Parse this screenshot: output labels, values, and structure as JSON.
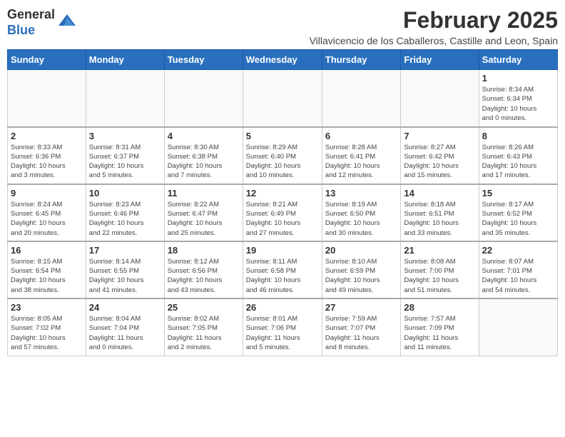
{
  "logo": {
    "general": "General",
    "blue": "Blue"
  },
  "title": {
    "month_year": "February 2025",
    "subtitle": "Villavicencio de los Caballeros, Castille and Leon, Spain"
  },
  "weekdays": [
    "Sunday",
    "Monday",
    "Tuesday",
    "Wednesday",
    "Thursday",
    "Friday",
    "Saturday"
  ],
  "days": [
    {
      "date": "",
      "info": ""
    },
    {
      "date": "",
      "info": ""
    },
    {
      "date": "",
      "info": ""
    },
    {
      "date": "",
      "info": ""
    },
    {
      "date": "",
      "info": ""
    },
    {
      "date": "",
      "info": ""
    },
    {
      "date": "1",
      "info": "Sunrise: 8:34 AM\nSunset: 6:34 PM\nDaylight: 10 hours\nand 0 minutes."
    },
    {
      "date": "2",
      "info": "Sunrise: 8:33 AM\nSunset: 6:36 PM\nDaylight: 10 hours\nand 3 minutes."
    },
    {
      "date": "3",
      "info": "Sunrise: 8:31 AM\nSunset: 6:37 PM\nDaylight: 10 hours\nand 5 minutes."
    },
    {
      "date": "4",
      "info": "Sunrise: 8:30 AM\nSunset: 6:38 PM\nDaylight: 10 hours\nand 7 minutes."
    },
    {
      "date": "5",
      "info": "Sunrise: 8:29 AM\nSunset: 6:40 PM\nDaylight: 10 hours\nand 10 minutes."
    },
    {
      "date": "6",
      "info": "Sunrise: 8:28 AM\nSunset: 6:41 PM\nDaylight: 10 hours\nand 12 minutes."
    },
    {
      "date": "7",
      "info": "Sunrise: 8:27 AM\nSunset: 6:42 PM\nDaylight: 10 hours\nand 15 minutes."
    },
    {
      "date": "8",
      "info": "Sunrise: 8:26 AM\nSunset: 6:43 PM\nDaylight: 10 hours\nand 17 minutes."
    },
    {
      "date": "9",
      "info": "Sunrise: 8:24 AM\nSunset: 6:45 PM\nDaylight: 10 hours\nand 20 minutes."
    },
    {
      "date": "10",
      "info": "Sunrise: 8:23 AM\nSunset: 6:46 PM\nDaylight: 10 hours\nand 22 minutes."
    },
    {
      "date": "11",
      "info": "Sunrise: 8:22 AM\nSunset: 6:47 PM\nDaylight: 10 hours\nand 25 minutes."
    },
    {
      "date": "12",
      "info": "Sunrise: 8:21 AM\nSunset: 6:49 PM\nDaylight: 10 hours\nand 27 minutes."
    },
    {
      "date": "13",
      "info": "Sunrise: 8:19 AM\nSunset: 6:50 PM\nDaylight: 10 hours\nand 30 minutes."
    },
    {
      "date": "14",
      "info": "Sunrise: 8:18 AM\nSunset: 6:51 PM\nDaylight: 10 hours\nand 33 minutes."
    },
    {
      "date": "15",
      "info": "Sunrise: 8:17 AM\nSunset: 6:52 PM\nDaylight: 10 hours\nand 35 minutes."
    },
    {
      "date": "16",
      "info": "Sunrise: 8:15 AM\nSunset: 6:54 PM\nDaylight: 10 hours\nand 38 minutes."
    },
    {
      "date": "17",
      "info": "Sunrise: 8:14 AM\nSunset: 6:55 PM\nDaylight: 10 hours\nand 41 minutes."
    },
    {
      "date": "18",
      "info": "Sunrise: 8:12 AM\nSunset: 6:56 PM\nDaylight: 10 hours\nand 43 minutes."
    },
    {
      "date": "19",
      "info": "Sunrise: 8:11 AM\nSunset: 6:58 PM\nDaylight: 10 hours\nand 46 minutes."
    },
    {
      "date": "20",
      "info": "Sunrise: 8:10 AM\nSunset: 6:59 PM\nDaylight: 10 hours\nand 49 minutes."
    },
    {
      "date": "21",
      "info": "Sunrise: 8:08 AM\nSunset: 7:00 PM\nDaylight: 10 hours\nand 51 minutes."
    },
    {
      "date": "22",
      "info": "Sunrise: 8:07 AM\nSunset: 7:01 PM\nDaylight: 10 hours\nand 54 minutes."
    },
    {
      "date": "23",
      "info": "Sunrise: 8:05 AM\nSunset: 7:02 PM\nDaylight: 10 hours\nand 57 minutes."
    },
    {
      "date": "24",
      "info": "Sunrise: 8:04 AM\nSunset: 7:04 PM\nDaylight: 11 hours\nand 0 minutes."
    },
    {
      "date": "25",
      "info": "Sunrise: 8:02 AM\nSunset: 7:05 PM\nDaylight: 11 hours\nand 2 minutes."
    },
    {
      "date": "26",
      "info": "Sunrise: 8:01 AM\nSunset: 7:06 PM\nDaylight: 11 hours\nand 5 minutes."
    },
    {
      "date": "27",
      "info": "Sunrise: 7:59 AM\nSunset: 7:07 PM\nDaylight: 11 hours\nand 8 minutes."
    },
    {
      "date": "28",
      "info": "Sunrise: 7:57 AM\nSunset: 7:09 PM\nDaylight: 11 hours\nand 11 minutes."
    },
    {
      "date": "",
      "info": ""
    }
  ]
}
